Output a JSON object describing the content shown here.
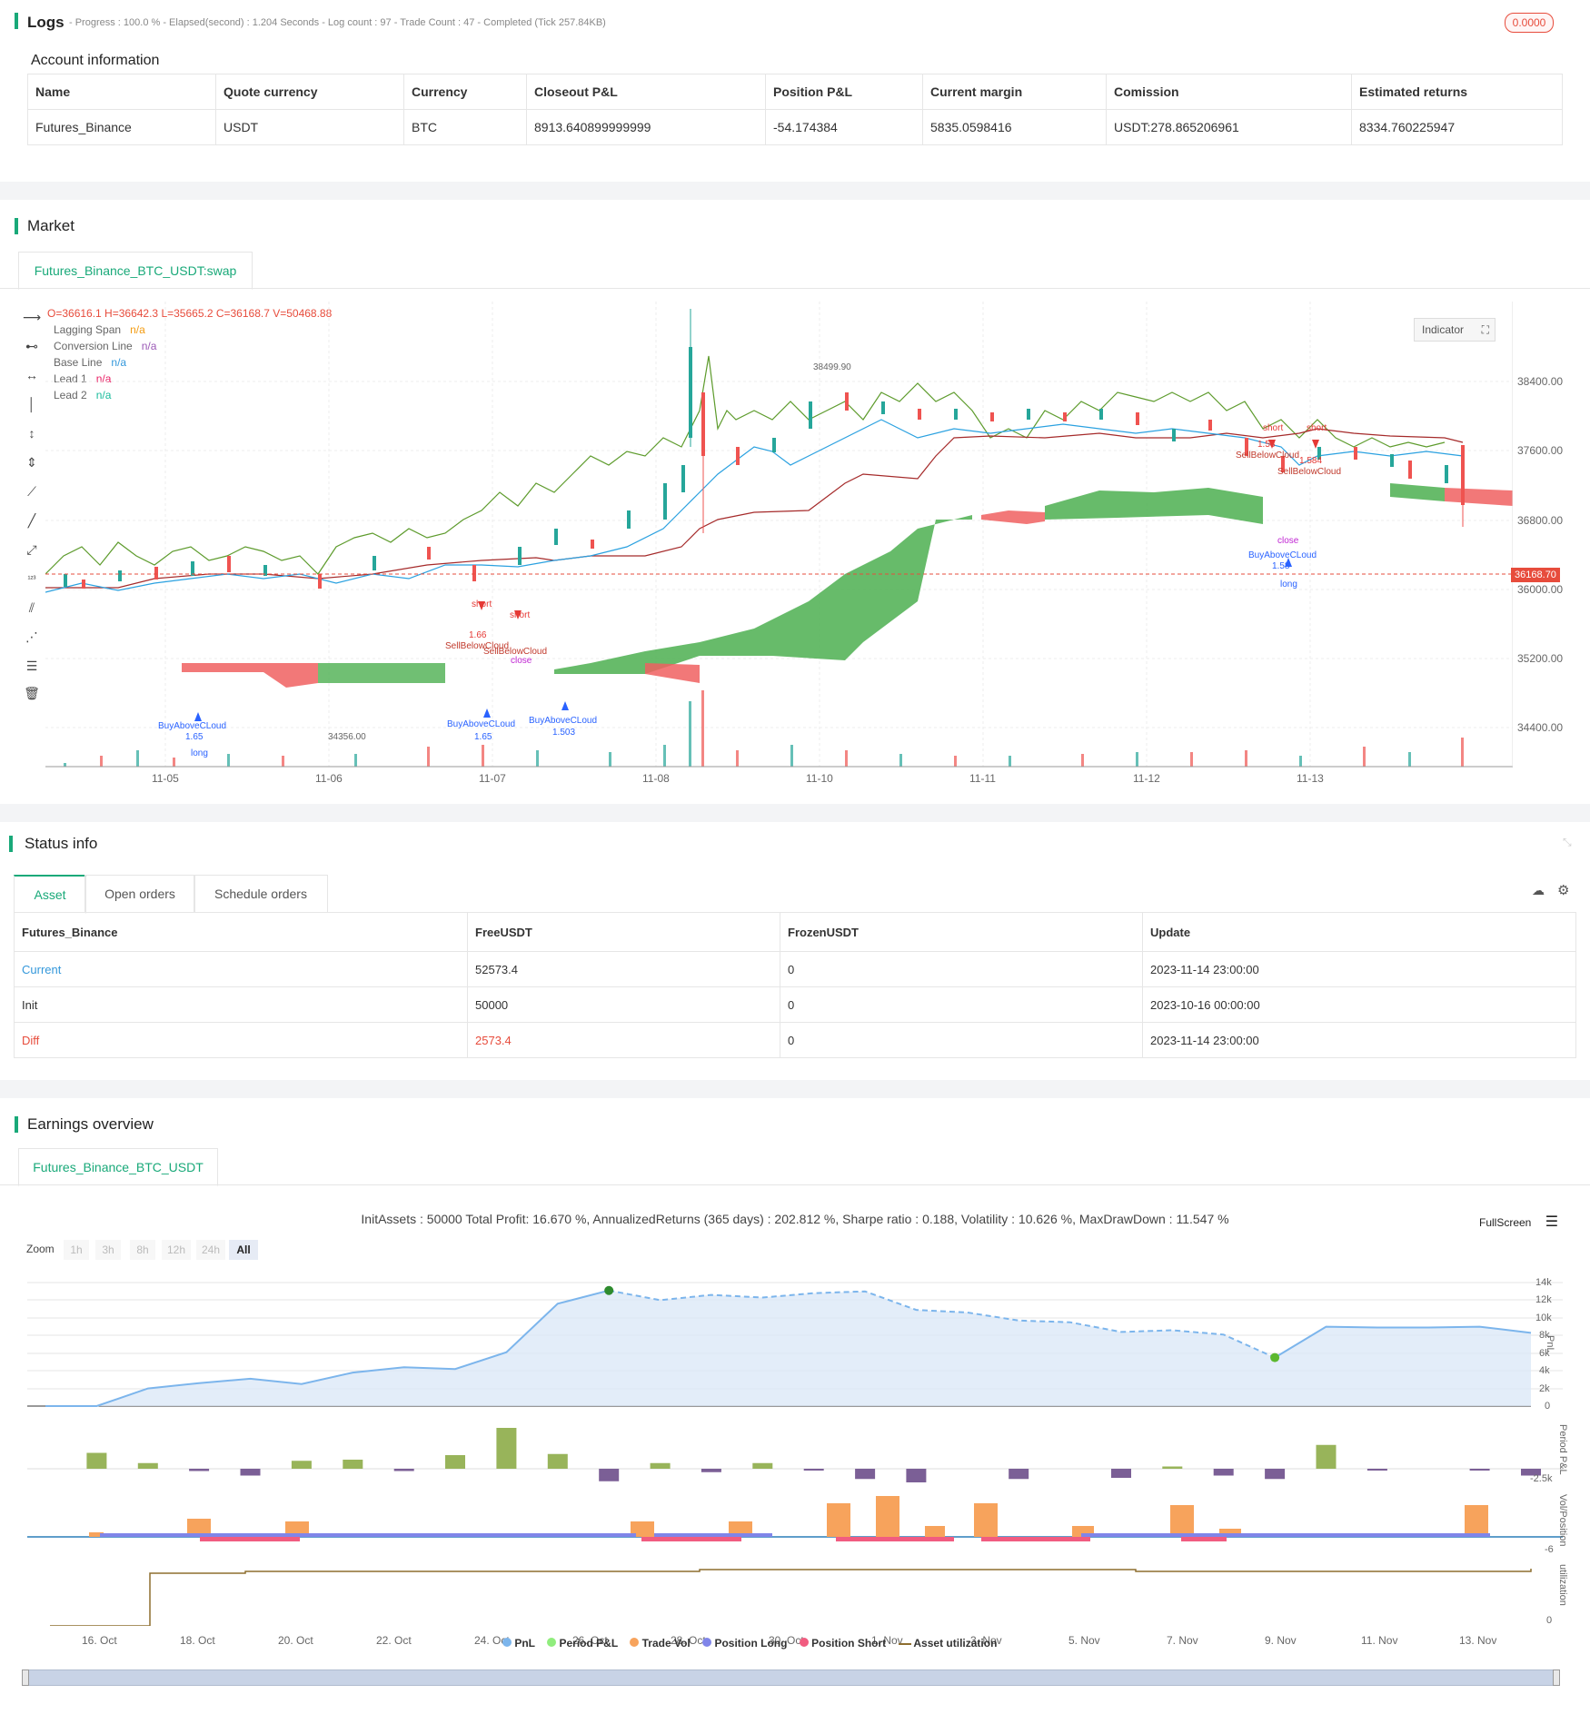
{
  "logs": {
    "title": "Logs",
    "meta": "- Progress : 100.0 % - Elapsed(second) : 1.204  Seconds - Log count : 97 - Trade Count : 47 - Completed (Tick 257.84KB)",
    "badge": "0.0000"
  },
  "account": {
    "title": "Account information",
    "headers": [
      "Name",
      "Quote currency",
      "Currency",
      "Closeout P&L",
      "Position P&L",
      "Current margin",
      "Comission",
      "Estimated returns"
    ],
    "row": [
      "Futures_Binance",
      "USDT",
      "BTC",
      "8913.640899999999",
      "-54.174384",
      "5835.0598416",
      "USDT:278.865206961",
      "8334.760225947"
    ]
  },
  "market": {
    "title": "Market",
    "tab": "Futures_Binance_BTC_USDT:swap",
    "ohlcv": "O=36616.1 H=36642.3 L=35665.2 C=36168.7 V=50468.88",
    "legend": [
      {
        "name": "Lagging Span",
        "value": "n/a",
        "color": "#f39c12"
      },
      {
        "name": "Conversion Line",
        "value": "n/a",
        "color": "#9b59b6"
      },
      {
        "name": "Base Line",
        "value": "n/a",
        "color": "#3498db"
      },
      {
        "name": "Lead 1",
        "value": "n/a",
        "color": "#e91e63"
      },
      {
        "name": "Lead 2",
        "value": "n/a",
        "color": "#1abc9c"
      }
    ],
    "indicator_btn": "Indicator",
    "y_labels": [
      "38400.00",
      "37600.00",
      "36800.00",
      "36000.00",
      "35200.00",
      "34400.00"
    ],
    "x_labels": [
      "11-05",
      "11-06",
      "11-07",
      "11-08",
      "11-10",
      "11-11",
      "11-12",
      "11-13"
    ],
    "price_tag": "36168.70",
    "high_marker": "38499.90",
    "low_marker": "34356.00",
    "annotations": {
      "short": "short",
      "long": "long",
      "close": "close",
      "buy": "BuyAboveCLoud",
      "sell": "SellBelowCloud",
      "v166": "1.66",
      "v165": "1.65",
      "v1503": "1.503",
      "v1584": "1.584",
      "v158": "1.58"
    }
  },
  "status": {
    "title": "Status info",
    "tabs": [
      "Asset",
      "Open orders",
      "Schedule orders"
    ],
    "headers": [
      "Futures_Binance",
      "FreeUSDT",
      "FrozenUSDT",
      "Update"
    ],
    "rows": [
      [
        "Current",
        "52573.4",
        "0",
        "2023-11-14 23:00:00"
      ],
      [
        "Init",
        "50000",
        "0",
        "2023-10-16 00:00:00"
      ],
      [
        "Diff",
        "2573.4",
        "0",
        "2023-11-14 23:00:00"
      ]
    ]
  },
  "earnings": {
    "title": "Earnings overview",
    "tab": "Futures_Binance_BTC_USDT",
    "summary": "InitAssets : 50000 Total Profit: 16.670 %, AnnualizedReturns (365 days) : 202.812 %, Sharpe ratio : 0.188, Volatility : 10.626 %, MaxDrawDown : 11.547 %",
    "fullscreen": "FullScreen",
    "zoom_label": "Zoom",
    "zoom_options": [
      "1h",
      "3h",
      "8h",
      "12h",
      "24h",
      "All"
    ],
    "pnl_y": [
      "14k",
      "12k",
      "10k",
      "8k",
      "6k",
      "4k",
      "2k",
      "0"
    ],
    "axis_names": [
      "PnL",
      "Period P&L",
      "Vol/Position",
      "utilization"
    ],
    "period_min": "-2.5k",
    "vol_min": "-6",
    "util_zero": "0",
    "x_labels": [
      "16. Oct",
      "18. Oct",
      "20. Oct",
      "22. Oct",
      "24. Oct",
      "26. Oct",
      "28. Oct",
      "30. Oct",
      "1. Nov",
      "3. Nov",
      "5. Nov",
      "7. Nov",
      "9. Nov",
      "11. Nov",
      "13. Nov"
    ],
    "legend": [
      {
        "name": "PnL",
        "color": "#7cb5ec"
      },
      {
        "name": "Period P&L",
        "color": "#90ed7d"
      },
      {
        "name": "Trade Vol",
        "color": "#f7a35c"
      },
      {
        "name": "Position Long",
        "color": "#8085e9"
      },
      {
        "name": "Position Short",
        "color": "#f15c80"
      },
      {
        "name": "Asset utilization",
        "color": "#8d6e2f"
      }
    ]
  },
  "chart_data": {
    "type": "line",
    "title": "",
    "x": [
      "16. Oct",
      "17. Oct",
      "18. Oct",
      "19. Oct",
      "20. Oct",
      "21. Oct",
      "22. Oct",
      "23. Oct",
      "24. Oct",
      "25. Oct",
      "26. Oct",
      "27. Oct",
      "28. Oct",
      "29. Oct",
      "30. Oct",
      "31. Oct",
      "1. Nov",
      "2. Nov",
      "3. Nov",
      "4. Nov",
      "5. Nov",
      "6. Nov",
      "7. Nov",
      "8. Nov",
      "9. Nov",
      "10. Nov",
      "11. Nov",
      "12. Nov",
      "13. Nov",
      "14. Nov"
    ],
    "series": [
      {
        "name": "PnL",
        "values": [
          0,
          0,
          2000,
          2600,
          3100,
          2500,
          3800,
          4400,
          4200,
          6100,
          11600,
          13100,
          12000,
          12600,
          12300,
          12800,
          13000,
          10900,
          10600,
          9700,
          9500,
          8400,
          8600,
          8100,
          5500,
          9000,
          8900,
          8900,
          9000,
          8300
        ]
      },
      {
        "name": "Period P&L",
        "values": [
          0,
          1400,
          500,
          -200,
          -600,
          700,
          800,
          -200,
          1200,
          3600,
          1300,
          -1100,
          500,
          -300,
          500,
          -100,
          -900,
          -1200,
          0,
          -900,
          0,
          -800,
          200,
          -600,
          -900,
          2100,
          -100,
          0,
          -100,
          -600
        ]
      }
    ],
    "ylim": [
      0,
      14000
    ]
  }
}
